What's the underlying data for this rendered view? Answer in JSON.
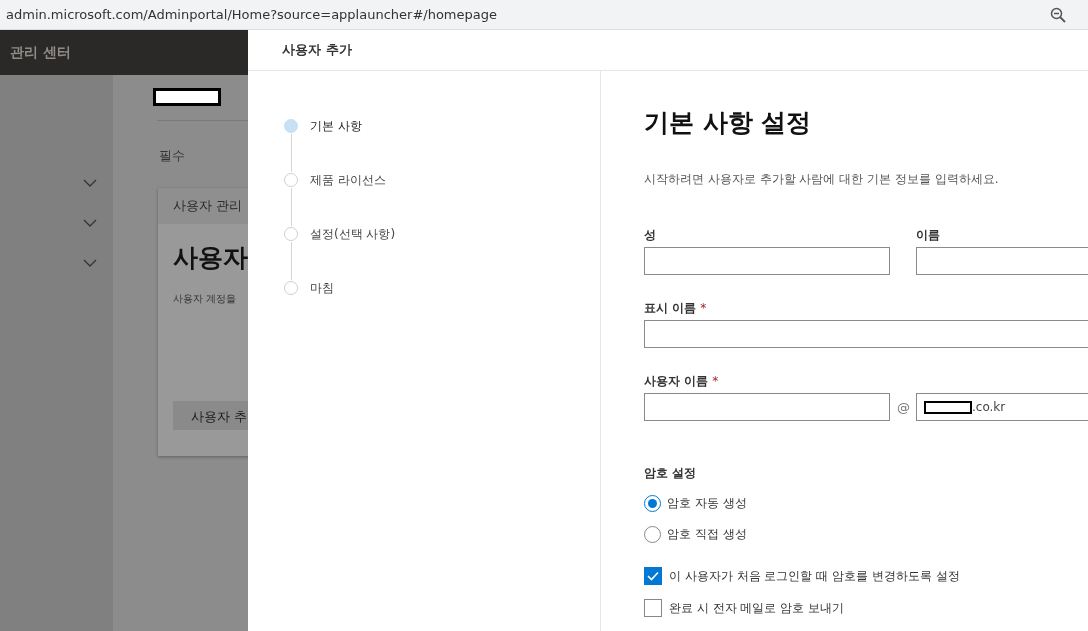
{
  "browser": {
    "url": "admin.microsoft.com/Adminportal/Home?source=applauncher#/homepage"
  },
  "background": {
    "header_title": "관리 센터",
    "section_label": "필수",
    "card": {
      "title": "사용자 관리",
      "heading": "사용자",
      "description": "사용자 계정을",
      "button": "사용자 추"
    }
  },
  "panel": {
    "title": "사용자 추가",
    "steps": [
      {
        "label": "기본 사항",
        "selected": true
      },
      {
        "label": "제품 라이선스",
        "selected": false
      },
      {
        "label": "설정(선택 사항)",
        "selected": false
      },
      {
        "label": "마침",
        "selected": false
      }
    ],
    "form": {
      "heading": "기본 사항 설정",
      "description": "시작하려면 사용자로 추가할 사람에 대한 기본 정보를 입력하세요.",
      "name_fields": [
        {
          "label": "성"
        },
        {
          "label": "이름"
        }
      ],
      "display_name": {
        "label": "표시 이름",
        "mark": "*"
      },
      "username": {
        "label": "사용자 이름",
        "mark": "*",
        "at": "@",
        "domain": ".co.kr"
      },
      "password": {
        "label": "암호 설정",
        "options": [
          {
            "label": "암호 자동 생성",
            "selected": true
          },
          {
            "label": "암호 직접 생성",
            "selected": false
          }
        ]
      },
      "checkboxes": [
        {
          "label": "이 사용자가 처음 로그인할 때 암호를 변경하도록 설정",
          "checked": true
        },
        {
          "label": "완료 시 전자 메일로 암호 보내기",
          "checked": false
        }
      ]
    }
  }
}
